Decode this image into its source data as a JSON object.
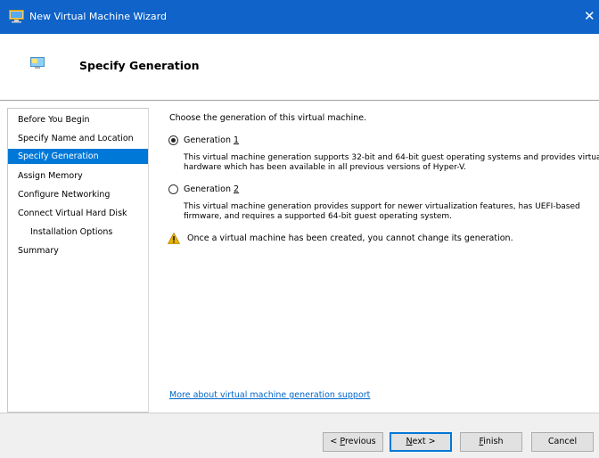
{
  "window": {
    "title": "New Virtual Machine Wizard",
    "close_glyph": "✕"
  },
  "header": {
    "title": "Specify Generation"
  },
  "nav": {
    "items": [
      {
        "label": "Before You Begin",
        "selected": false,
        "sub": false
      },
      {
        "label": "Specify Name and Location",
        "selected": false,
        "sub": false
      },
      {
        "label": "Specify Generation",
        "selected": true,
        "sub": false
      },
      {
        "label": "Assign Memory",
        "selected": false,
        "sub": false
      },
      {
        "label": "Configure Networking",
        "selected": false,
        "sub": false
      },
      {
        "label": "Connect Virtual Hard Disk",
        "selected": false,
        "sub": false
      },
      {
        "label": "Installation Options",
        "selected": false,
        "sub": true
      },
      {
        "label": "Summary",
        "selected": false,
        "sub": false
      }
    ]
  },
  "content": {
    "prompt": "Choose the generation of this virtual machine.",
    "gen1": {
      "label_prefix": "Generation ",
      "label_key": "1",
      "checked": true,
      "description": "This virtual machine generation supports 32-bit and 64-bit guest operating systems and provides virtual hardware which has been available in all previous versions of Hyper-V."
    },
    "gen2": {
      "label_prefix": "Generation ",
      "label_key": "2",
      "checked": false,
      "description": "This virtual machine generation provides support for newer virtualization features, has UEFI-based firmware, and requires a supported 64-bit guest operating system."
    },
    "warning": "Once a virtual machine has been created, you cannot change its generation.",
    "more_link": "More about virtual machine generation support"
  },
  "buttons": {
    "previous": {
      "prefix": "< ",
      "key": "P",
      "rest": "revious"
    },
    "next": {
      "prefix": "",
      "key": "N",
      "rest": "ext >"
    },
    "finish": {
      "prefix": "",
      "key": "F",
      "rest": "inish"
    },
    "cancel": {
      "label": "Cancel"
    }
  },
  "colors": {
    "titlebar": "#0f63c9",
    "selection": "#0078d7",
    "link": "#0066cc",
    "warning": "#e8b400"
  },
  "icons": {
    "app": "monitor-icon",
    "header": "monitor-icon",
    "warning": "warning-icon"
  }
}
